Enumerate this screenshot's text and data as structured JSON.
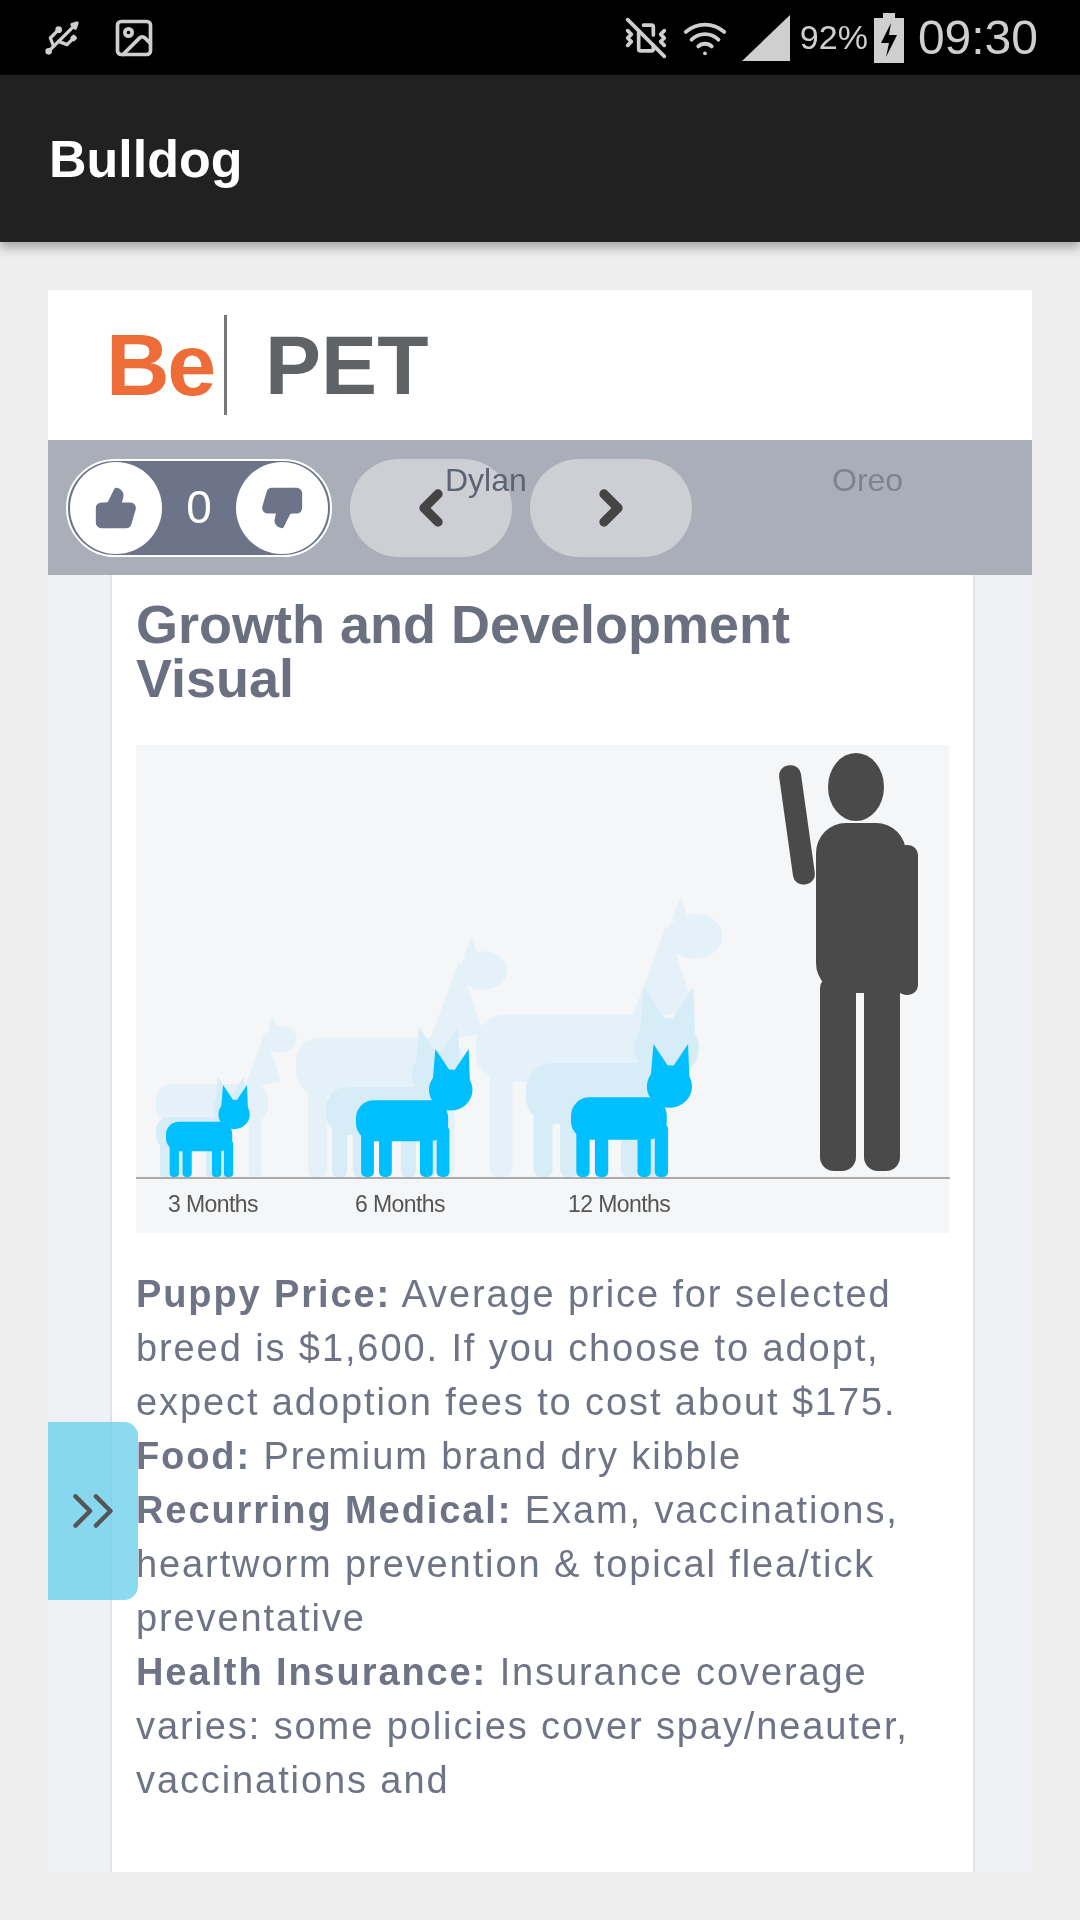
{
  "status_bar": {
    "battery": "92%",
    "time": "09:30"
  },
  "app_bar": {
    "title": "Bulldog"
  },
  "logo": {
    "left": "Be",
    "right": "PET"
  },
  "toolbar": {
    "vote_count": "0",
    "names": [
      "Dylan",
      "Oreo"
    ]
  },
  "article": {
    "heading": "Growth and Development Visual",
    "chart_labels": [
      "3 Months",
      "6 Months",
      "12 Months"
    ],
    "paragraphs": [
      "**Puppy Price:** Average price for selected breed is $1,600. If you choose to adopt, expect adoption fees to cost about $175.",
      "**Food:** Premium brand dry kibble",
      "**Recurring Medical:** Exam, vaccinations, heartworm prevention & topical flea/tick preventative",
      "**Health Insurance:** Insurance coverage varies: some policies cover spay/neauter, vaccinations and"
    ]
  }
}
